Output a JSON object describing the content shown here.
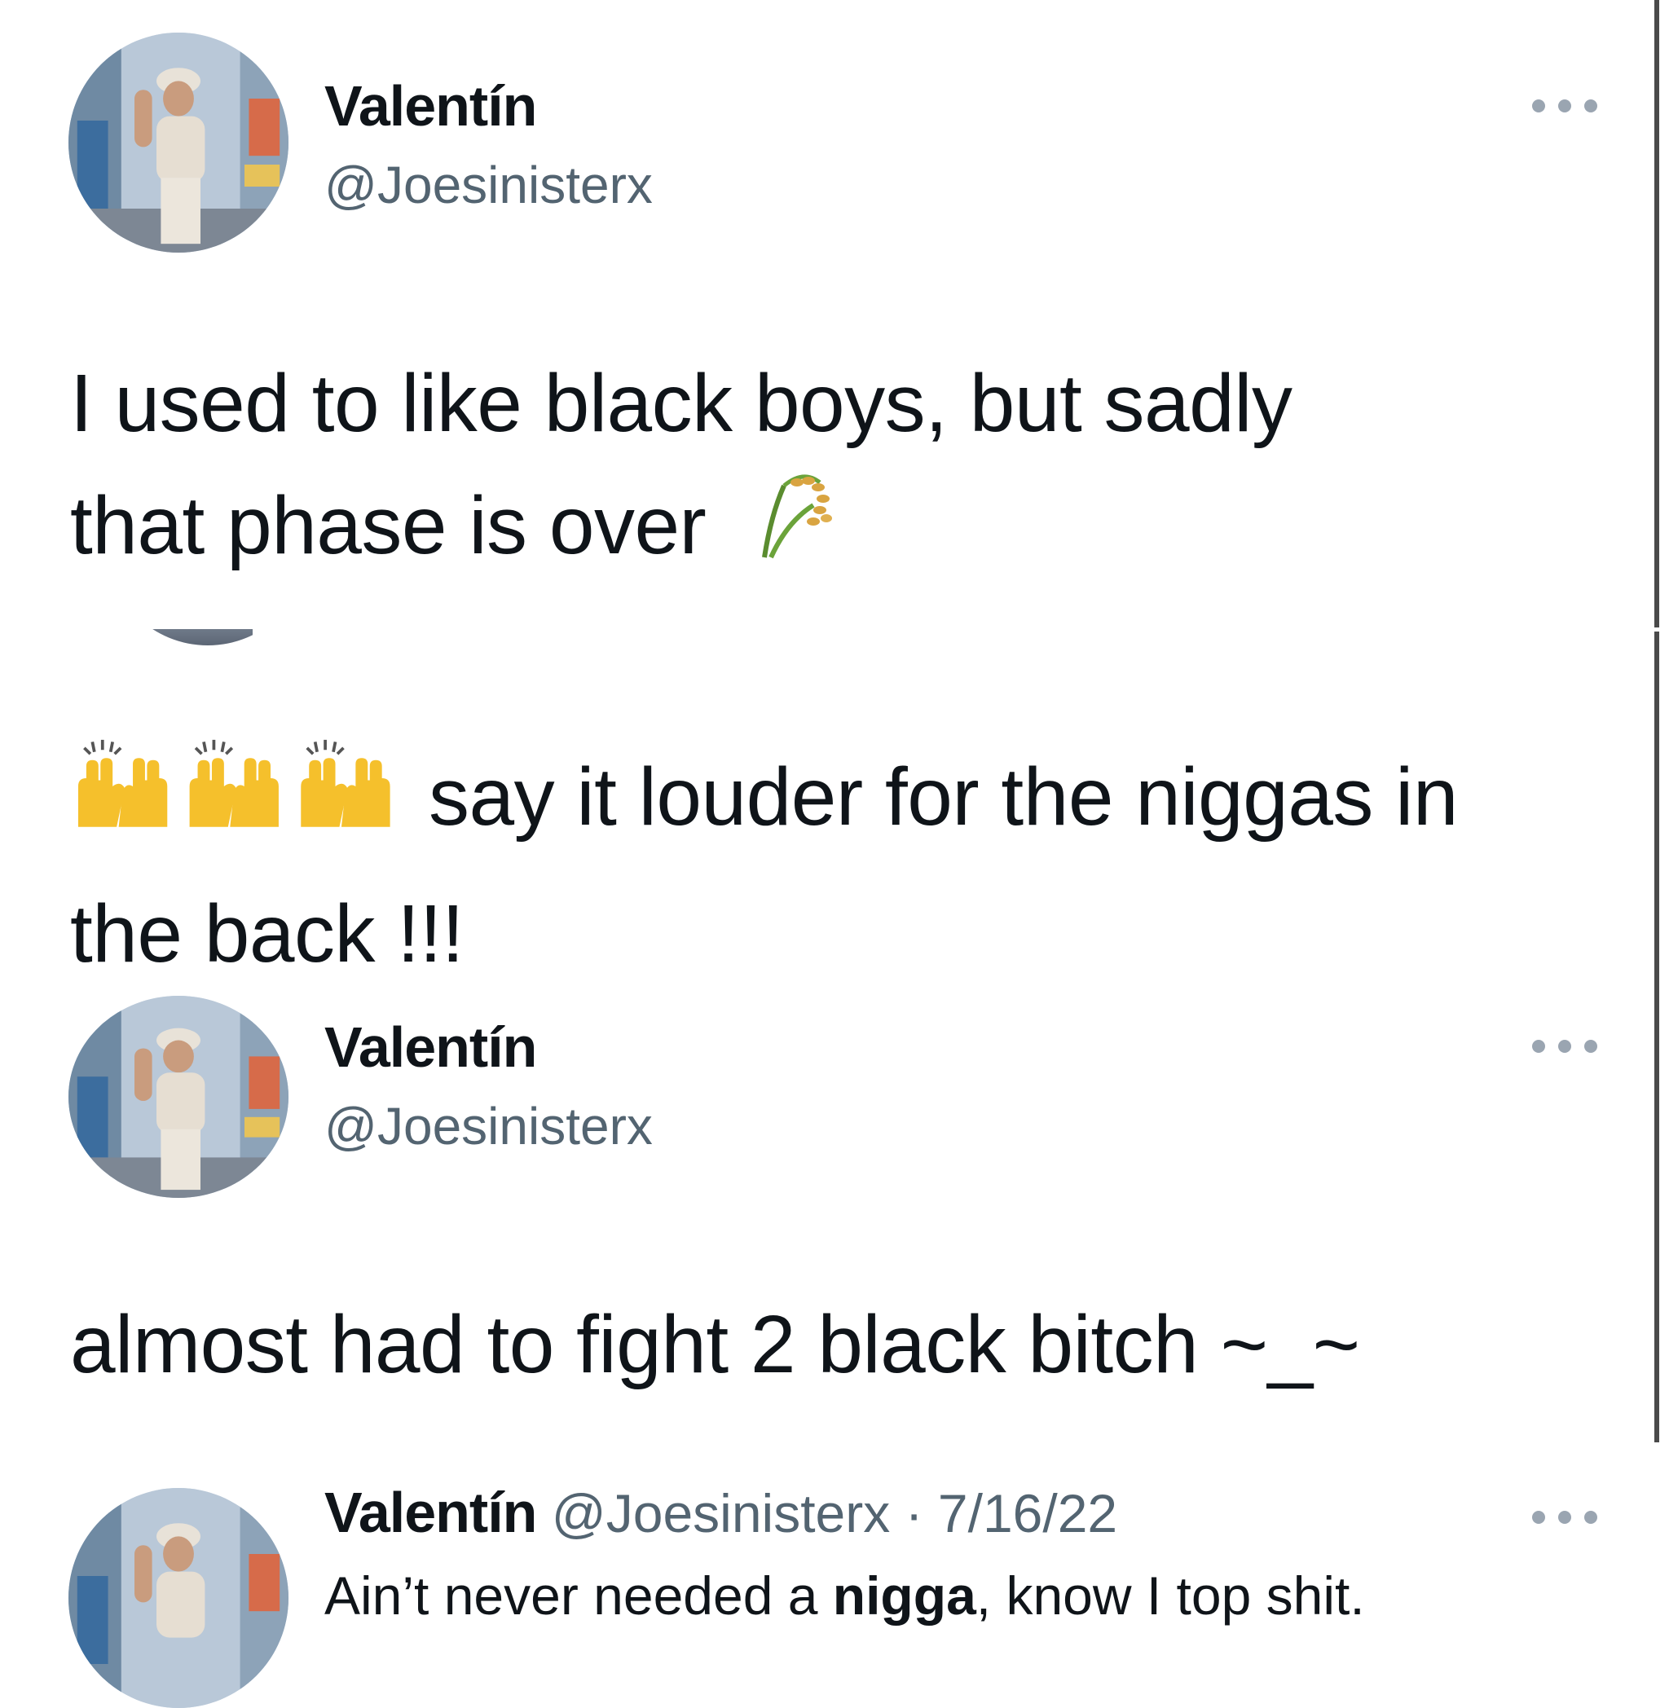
{
  "tweets": [
    {
      "display_name": "Valentín",
      "handle": "@Joesinisterx",
      "text_line1": "I used to like black boys, but sadly",
      "text_line2": "that phase is over",
      "emoji": "rice-plant"
    },
    {
      "text_line1": "say it louder for the niggas in",
      "text_line2": "the back !!!",
      "emoji": "raising-hands"
    },
    {
      "display_name": "Valentín",
      "handle": "@Joesinisterx",
      "text_line1": "almost had to fight 2 black bitch ~_~"
    },
    {
      "display_name": "Valentín",
      "handle": "@Joesinisterx",
      "separator": "·",
      "date": "7/16/22",
      "text_before": "Ain’t never needed a ",
      "text_bold": "nigga",
      "text_after": ", know I top shit."
    }
  ],
  "icons": {
    "more": "more-options-icon",
    "avatar": "avatar-photo",
    "rice": "rice-emoji",
    "hands": "raising-hands-emoji"
  },
  "colors": {
    "text_primary": "#0f1419",
    "text_secondary": "#536471",
    "dots": "#9aa5b1"
  }
}
